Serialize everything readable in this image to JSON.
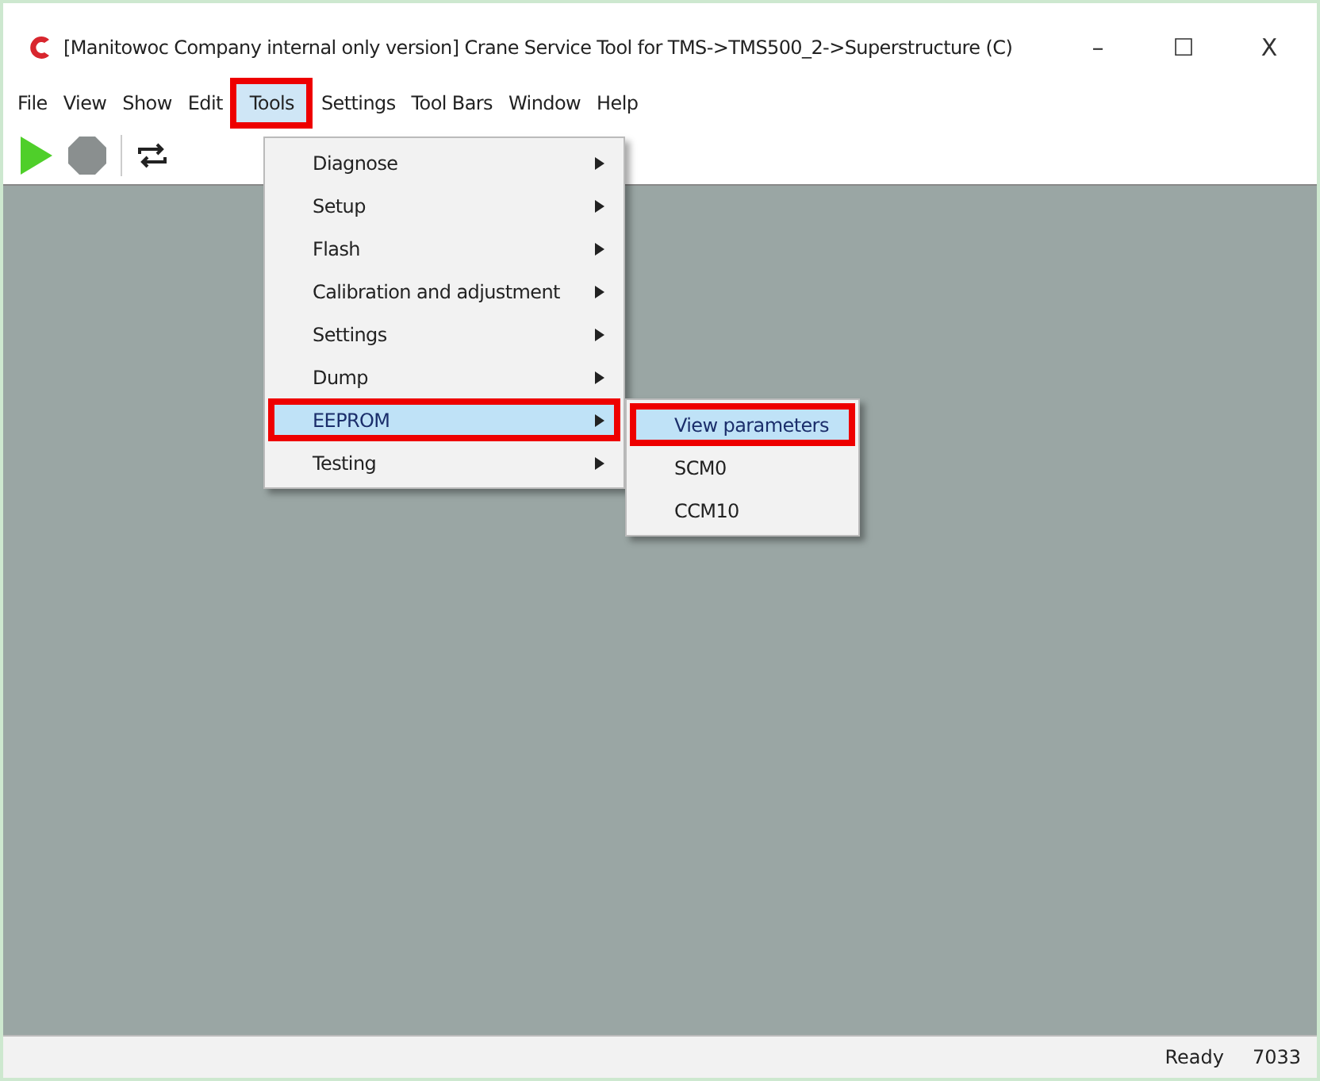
{
  "window": {
    "title": "[Manitowoc Company internal only  version] Crane Service Tool for TMS->TMS500_2->Superstructure (C)",
    "controls": [
      "–",
      "☐",
      "X"
    ]
  },
  "menu_bar": [
    {
      "label": "File",
      "selected": false,
      "highlighted": false
    },
    {
      "label": "View",
      "selected": false,
      "highlighted": false
    },
    {
      "label": "Show",
      "selected": false,
      "highlighted": false
    },
    {
      "label": "Edit",
      "selected": false,
      "highlighted": false
    },
    {
      "label": "Tools",
      "selected": true,
      "highlighted": true
    },
    {
      "label": "Settings",
      "selected": false,
      "highlighted": false
    },
    {
      "label": "Tool Bars",
      "selected": false,
      "highlighted": false
    },
    {
      "label": "Window",
      "selected": false,
      "highlighted": false
    },
    {
      "label": "Help",
      "selected": false,
      "highlighted": false
    }
  ],
  "toolbar": [
    {
      "kind": "play"
    },
    {
      "kind": "stop"
    },
    {
      "kind": "refresh"
    }
  ],
  "tools_menu": [
    {
      "label": "Diagnose",
      "selected": false,
      "highlighted": false
    },
    {
      "label": "Setup",
      "selected": false,
      "highlighted": false
    },
    {
      "label": "Flash",
      "selected": false,
      "highlighted": false
    },
    {
      "label": "Calibration and adjustment",
      "selected": false,
      "highlighted": false
    },
    {
      "label": "Settings",
      "selected": false,
      "highlighted": false
    },
    {
      "label": "Dump",
      "selected": false,
      "highlighted": false
    },
    {
      "label": "EEPROM",
      "selected": true,
      "highlighted": true
    },
    {
      "label": "Testing",
      "selected": false,
      "highlighted": false
    }
  ],
  "submenu": [
    {
      "label": "View parameters",
      "selected": true,
      "highlighted": true
    },
    {
      "label": "SCM0",
      "selected": false,
      "highlighted": false
    },
    {
      "label": "CCM10",
      "selected": false,
      "highlighted": false
    }
  ],
  "status_bar": {
    "status": "Ready",
    "code": "7033"
  }
}
